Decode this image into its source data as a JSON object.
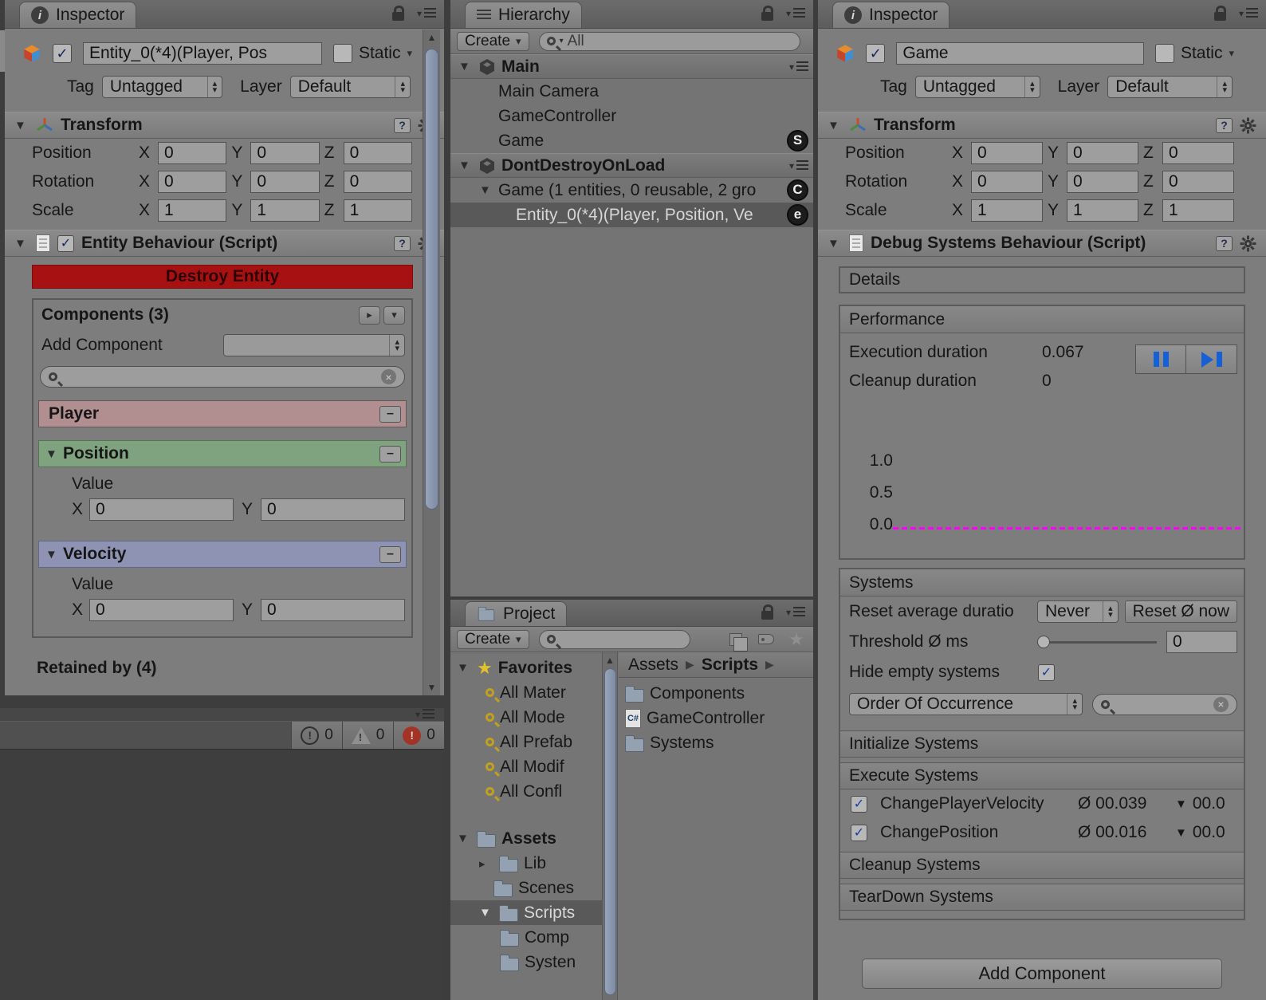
{
  "axes": {
    "x": "X",
    "y": "Y",
    "z": "Z"
  },
  "icons": {
    "csharp_label": "C#"
  },
  "colors": {
    "graph_line": "#ff00ff",
    "destroy_button": "#a81111",
    "player_header": "#b18e90",
    "position_header": "#7fa27f",
    "velocity_header": "#8e93b4",
    "selection": "#595959",
    "media_icon_blue": "#1560d4"
  },
  "left_inspector": {
    "tab": "Inspector",
    "name_value": "Entity_0(*4)(Player, Pos",
    "static_label": "Static",
    "tag_label": "Tag",
    "tag_value": "Untagged",
    "layer_label": "Layer",
    "layer_value": "Default",
    "transform": {
      "title": "Transform",
      "rows": [
        {
          "label": "Position",
          "x": "0",
          "y": "0",
          "z": "0"
        },
        {
          "label": "Rotation",
          "x": "0",
          "y": "0",
          "z": "0"
        },
        {
          "label": "Scale",
          "x": "1",
          "y": "1",
          "z": "1"
        }
      ]
    },
    "behaviour": {
      "title": "Entity Behaviour (Script)",
      "destroy_button": "Destroy Entity",
      "components_header": "Components (3)",
      "add_component_label": "Add Component",
      "player_title": "Player",
      "position_title": "Position",
      "velocity_title": "Velocity",
      "value_label": "Value",
      "position_x": "0",
      "position_y": "0",
      "velocity_x": "0",
      "velocity_y": "0",
      "retained_label": "Retained by (4)"
    }
  },
  "console": {
    "info_count": "0",
    "warning_count": "0",
    "error_count": "0"
  },
  "hierarchy": {
    "tab": "Hierarchy",
    "create_button": "Create",
    "search_filter": "All",
    "scene_main": "Main",
    "main_children": [
      "Main Camera",
      "GameController",
      "Game"
    ],
    "game_badge": "S",
    "scene_ddol": "DontDestroyOnLoad",
    "group_item": "Game (1 entities, 0 reusable, 2 gro",
    "group_badge": "C",
    "entity_item": "Entity_0(*4)(Player, Position, Ve",
    "entity_badge": "e"
  },
  "project": {
    "tab": "Project",
    "create_button": "Create",
    "favorites_label": "Favorites",
    "favorites": [
      "All Mater",
      "All Mode",
      "All Prefab",
      "All Modif",
      "All Confl"
    ],
    "assets_label": "Assets",
    "folders": [
      "Lib",
      "Scenes",
      "Scripts",
      "Comp",
      "Systen"
    ],
    "breadcrumb_root": "Assets",
    "breadcrumb_current": "Scripts",
    "files": [
      "Components",
      "GameController",
      "Systems"
    ]
  },
  "right_inspector": {
    "tab": "Inspector",
    "name_value": "Game",
    "static_label": "Static",
    "tag_label": "Tag",
    "tag_value": "Untagged",
    "layer_label": "Layer",
    "layer_value": "Default",
    "transform": {
      "title": "Transform",
      "rows": [
        {
          "label": "Position",
          "x": "0",
          "y": "0",
          "z": "0"
        },
        {
          "label": "Rotation",
          "x": "0",
          "y": "0",
          "z": "0"
        },
        {
          "label": "Scale",
          "x": "1",
          "y": "1",
          "z": "1"
        }
      ]
    },
    "debug": {
      "title": "Debug Systems Behaviour (Script)",
      "details_label": "Details",
      "performance_title": "Performance",
      "execution_label": "Execution duration",
      "execution_value": "0.067",
      "cleanup_label": "Cleanup duration",
      "cleanup_value": "0",
      "graph_ticks": [
        "1.0",
        "0.5",
        "0.0"
      ],
      "systems_title": "Systems",
      "reset_avg_label": "Reset average duratio",
      "reset_avg_value": "Never",
      "reset_now_button": "Reset Ø now",
      "threshold_label": "Threshold Ø ms",
      "threshold_value": "0",
      "hide_empty_label": "Hide empty systems",
      "order_value": "Order Of Occurrence",
      "initialize_header": "Initialize Systems",
      "execute_header": "Execute Systems",
      "execute_rows": [
        {
          "name": "ChangePlayerVelocity",
          "avg": "Ø 00.039",
          "max": "00.0"
        },
        {
          "name": "ChangePosition",
          "avg": "Ø 00.016",
          "max": "00.0"
        }
      ],
      "cleanup_header": "Cleanup Systems",
      "teardown_header": "TearDown Systems",
      "add_component_button": "Add Component"
    }
  }
}
